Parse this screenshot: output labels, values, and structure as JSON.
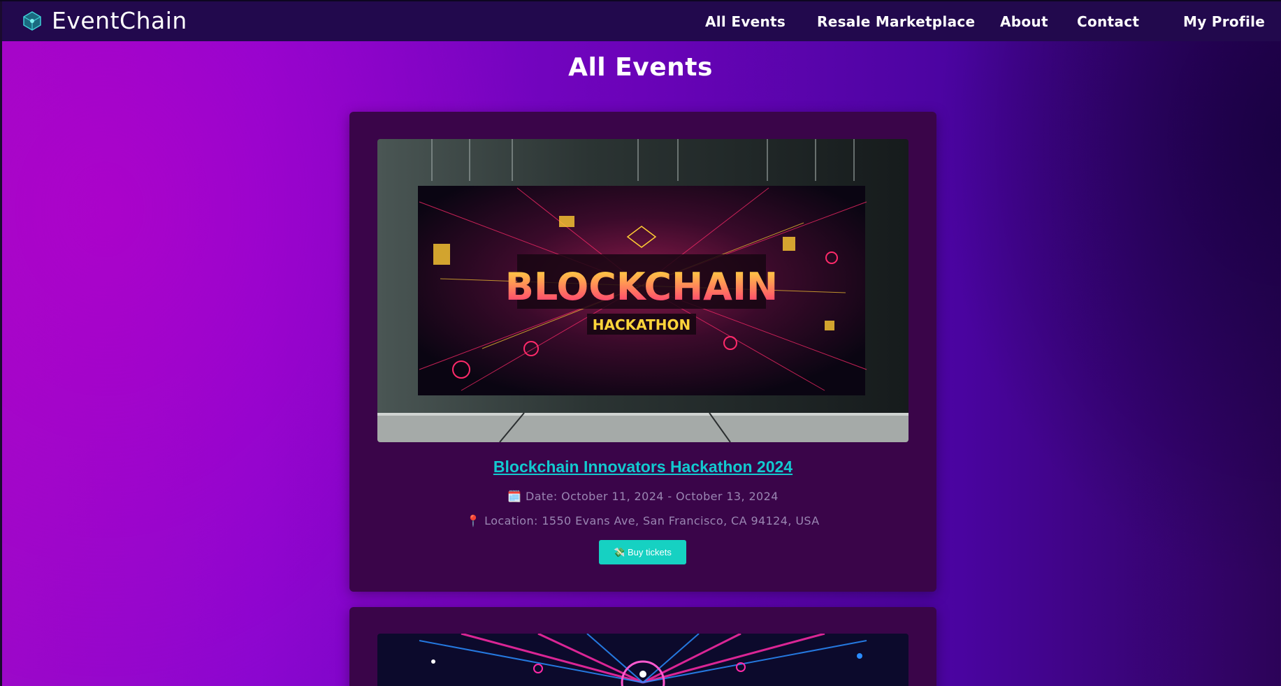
{
  "navbar": {
    "brand": "EventChain",
    "links": [
      "All Events",
      "Resale Marketplace",
      "About",
      "Contact"
    ],
    "profile": "My Profile"
  },
  "page": {
    "title": "All Events"
  },
  "events": [
    {
      "title": "Blockchain Innovators Hackathon 2024",
      "date": "🗓️ Date: October 11, 2024 - October 13, 2024",
      "location": "📍 Location: 1550 Evans Ave, San Francisco, CA 94124, USA",
      "button": "💸 Buy tickets",
      "banner_title": "BLOCKCHAIN",
      "banner_subtitle": "HACKATHON"
    }
  ],
  "colors": {
    "accent": "#16d1c2",
    "link": "#12c9cf",
    "navbar": "#22094d",
    "card": "#3a0549"
  }
}
